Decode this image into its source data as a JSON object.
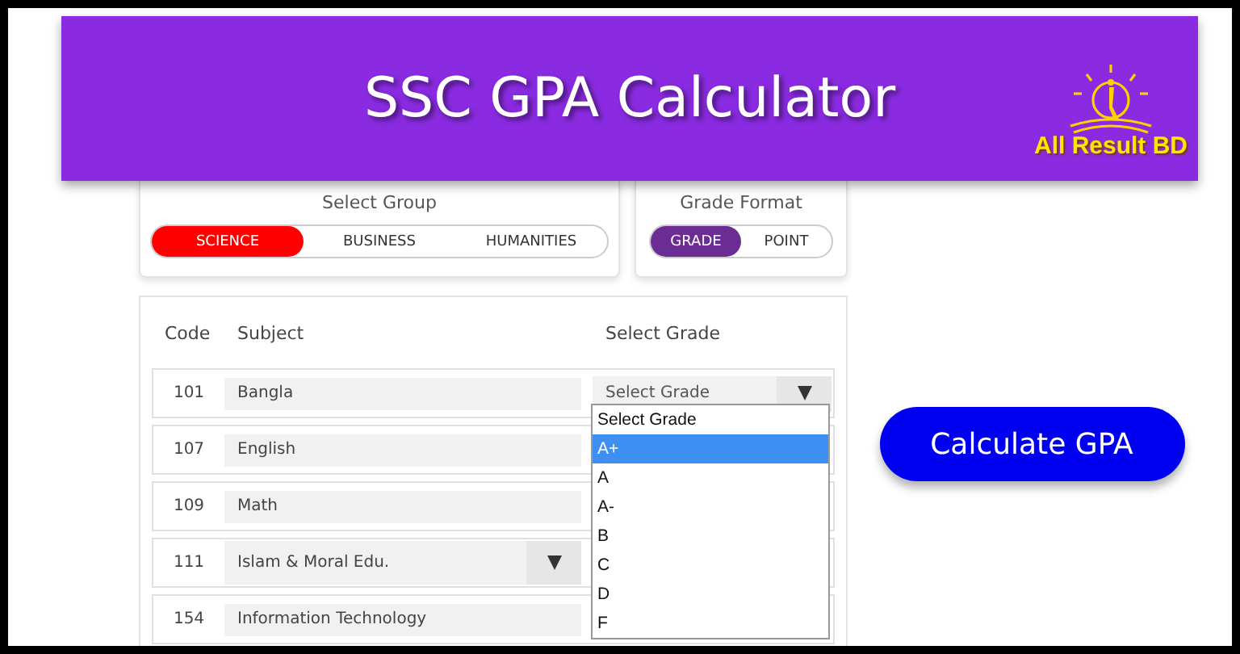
{
  "banner": {
    "title": "SSC GPA Calculator",
    "logo_text": "All Result BD"
  },
  "group": {
    "label": "Select Group",
    "options": [
      {
        "label": "SCIENCE",
        "selected": true
      },
      {
        "label": "BUSINESS",
        "selected": false
      },
      {
        "label": "HUMANITIES",
        "selected": false
      }
    ]
  },
  "grade_format": {
    "label": "Grade Format",
    "options": [
      {
        "label": "GRADE",
        "selected": true
      },
      {
        "label": "POINT",
        "selected": false
      }
    ]
  },
  "table": {
    "columns": [
      "Code",
      "Subject",
      "Select Grade"
    ],
    "rows": [
      {
        "code": "101",
        "subject": "Bangla",
        "kind": "text",
        "grade": "Select Grade"
      },
      {
        "code": "107",
        "subject": "English",
        "kind": "text"
      },
      {
        "code": "109",
        "subject": "Math",
        "kind": "text"
      },
      {
        "code": "111",
        "subject": "Islam & Moral Edu.",
        "kind": "select"
      },
      {
        "code": "154",
        "subject": "Information Technology",
        "kind": "text"
      }
    ]
  },
  "dropdown": {
    "options": [
      {
        "label": "Select Grade",
        "selected": false
      },
      {
        "label": "A+",
        "selected": true
      },
      {
        "label": "A",
        "selected": false
      },
      {
        "label": "A-",
        "selected": false
      },
      {
        "label": "B",
        "selected": false
      },
      {
        "label": "C",
        "selected": false
      },
      {
        "label": "D",
        "selected": false
      },
      {
        "label": "F",
        "selected": false
      }
    ]
  },
  "button": "Calculate GPA"
}
